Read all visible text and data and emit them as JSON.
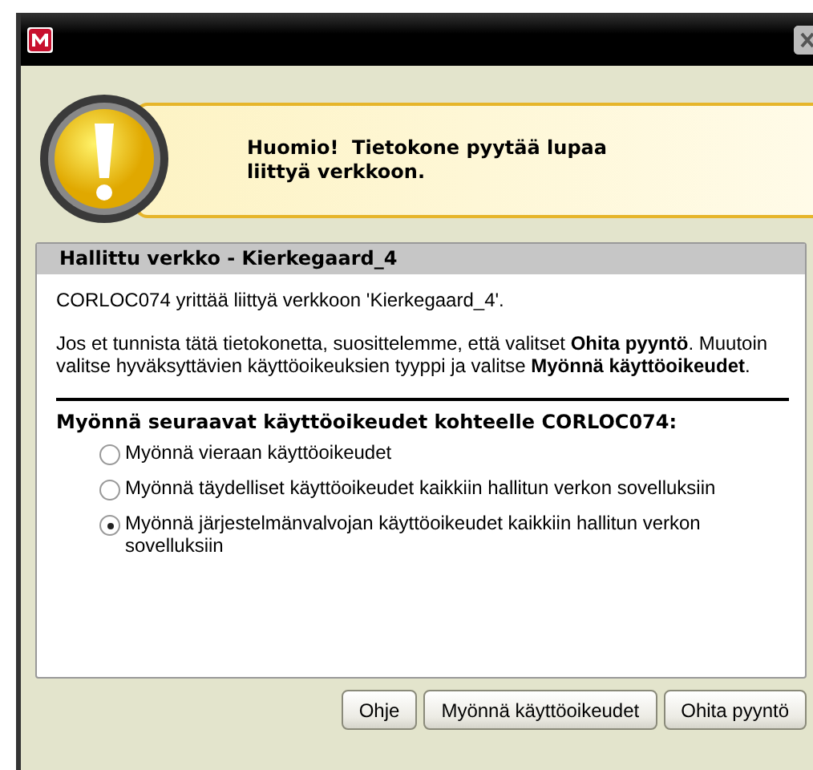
{
  "alert": {
    "text": "Huomio!  Tietokone pyytää lupaa liittyä verkkoon."
  },
  "panel": {
    "heading": "Hallittu verkko - Kierkegaard_4",
    "message": "CORLOC074 yrittää liittyä verkkoon 'Kierkegaard_4'.",
    "instructions": "Jos et tunnista tätä tietokonetta, suosittelemme, että valitset **Ohita pyyntö**. Muutoin valitse hyväksyttävien käyttöoikeuksien tyyppi ja valitse **Myönnä käyttöoikeudet**.",
    "group_label": "Myönnä seuraavat käyttöoikeudet kohteelle CORLOC074:",
    "options": [
      {
        "label": "Myönnä vieraan käyttöoikeudet",
        "selected": false
      },
      {
        "label": "Myönnä täydelliset käyttöoikeudet kaikkiin hallitun verkon sovelluksiin",
        "selected": false
      },
      {
        "label": "Myönnä järjestelmänvalvojan käyttöoikeudet kaikkiin hallitun verkon sovelluksiin",
        "selected": true
      }
    ]
  },
  "buttons": [
    "Ohje",
    "Myönnä käyttöoikeudet",
    "Ohita pyyntö"
  ]
}
